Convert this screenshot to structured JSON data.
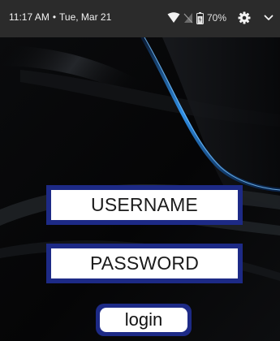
{
  "status_bar": {
    "time": "11:17 AM",
    "separator": "•",
    "date": "Tue, Mar 21",
    "battery_percent": "70%",
    "icons": [
      "wifi-icon",
      "signal-icon",
      "battery-icon",
      "gear-icon",
      "chevron-down-icon"
    ]
  },
  "login_form": {
    "username_placeholder": "USERNAME",
    "password_placeholder": "PASSWORD",
    "login_label": "login"
  },
  "colors": {
    "field_border": "#1d2a86",
    "status_bar_bg": "#2b2b2b",
    "wallpaper_accent": "#2c8be0"
  }
}
